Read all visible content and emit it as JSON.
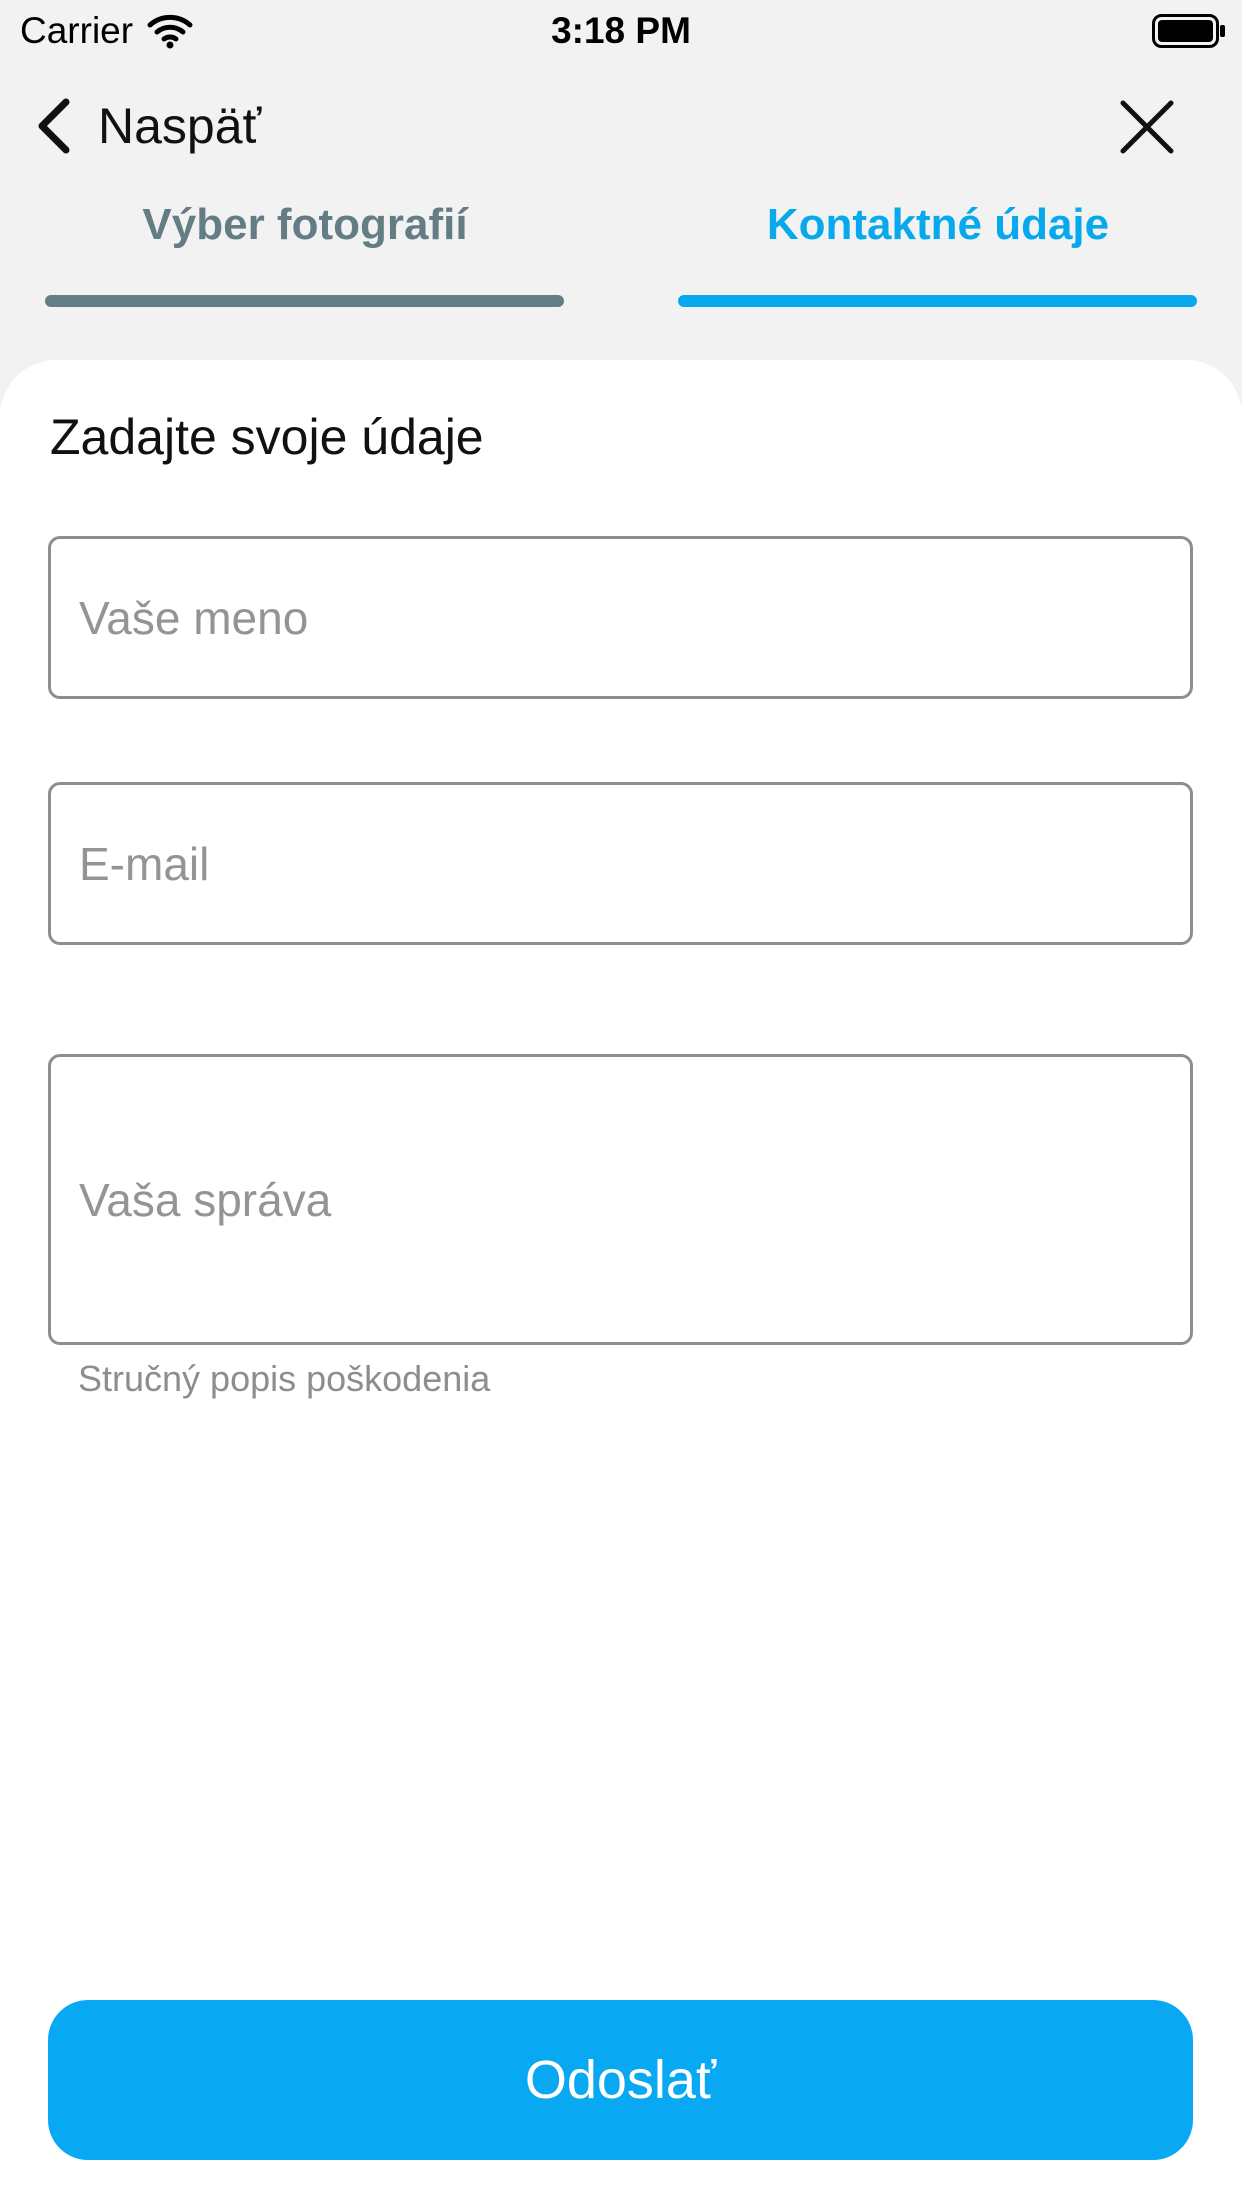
{
  "status_bar": {
    "carrier": "Carrier",
    "time": "3:18 PM"
  },
  "nav": {
    "back_label": "Naspäť"
  },
  "tabs": [
    {
      "label": "Výber fotografií",
      "color": "#647d85",
      "active": false
    },
    {
      "label": "Kontaktné údaje",
      "color": "#08a9ec",
      "active": true
    }
  ],
  "form": {
    "heading": "Zadajte svoje údaje",
    "name_placeholder": "Vaše meno",
    "email_placeholder": "E-mail",
    "message_placeholder": "Vaša správa",
    "message_helper": "Stručný popis poškodenia"
  },
  "submit": {
    "label": "Odoslať",
    "color": "#08a9f2"
  },
  "icons": {
    "wifi": "wifi-icon",
    "battery": "battery-icon",
    "back": "chevron-left-icon",
    "close": "close-icon"
  }
}
